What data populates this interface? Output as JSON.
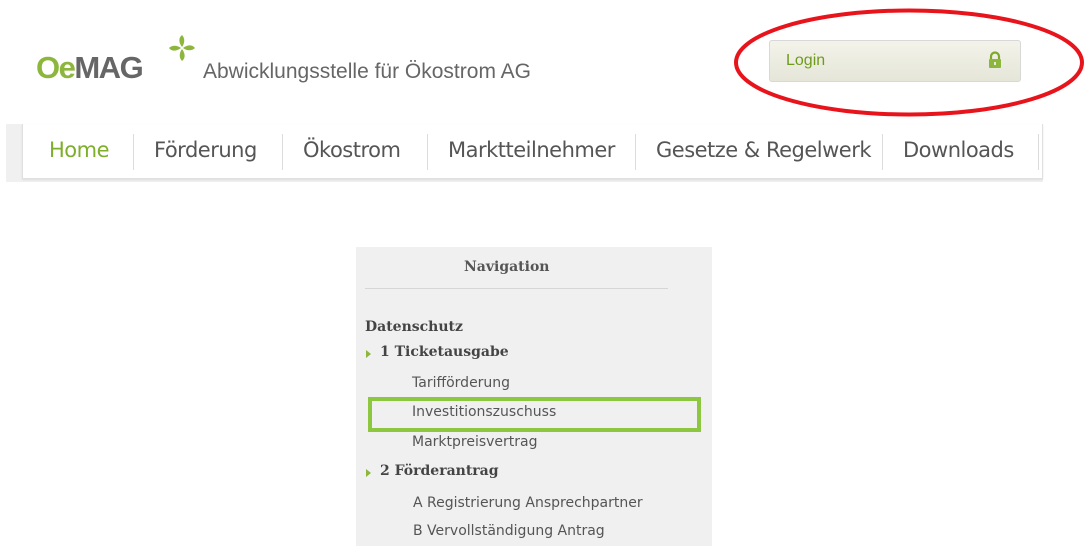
{
  "header": {
    "logo_oe": "Oe",
    "logo_mag": "MAG",
    "tagline": "Abwicklungsstelle für Ökostrom AG",
    "login_label": "Login",
    "login_icon": "lock-icon",
    "brand_green": "#8db63c"
  },
  "nav": {
    "items": [
      {
        "label": "Home",
        "active": true
      },
      {
        "label": "Förderung"
      },
      {
        "label": "Ökostrom"
      },
      {
        "label": "Marktteilnehmer"
      },
      {
        "label": "Gesetze & Regelwerk"
      },
      {
        "label": "Downloads"
      }
    ]
  },
  "sidebar": {
    "title": "Navigation",
    "items": [
      {
        "label": "Datenschutz",
        "type": "heading"
      },
      {
        "label": "1 Ticketausgabe",
        "type": "section",
        "icon": "arrow-right-icon"
      },
      {
        "label": "Tarifförderung",
        "type": "link"
      },
      {
        "label": "Investitionszuschuss",
        "type": "link",
        "highlighted": true
      },
      {
        "label": "Marktpreisvertrag",
        "type": "link"
      },
      {
        "label": "2 Förderantrag",
        "type": "section",
        "icon": "arrow-right-icon"
      },
      {
        "label": "A Registrierung Ansprechpartner",
        "type": "link"
      },
      {
        "label": "B Vervollständigung Antrag",
        "type": "link"
      }
    ]
  },
  "annotations": {
    "ellipse_color": "#e8141c",
    "box_color": "#8dc63f"
  }
}
